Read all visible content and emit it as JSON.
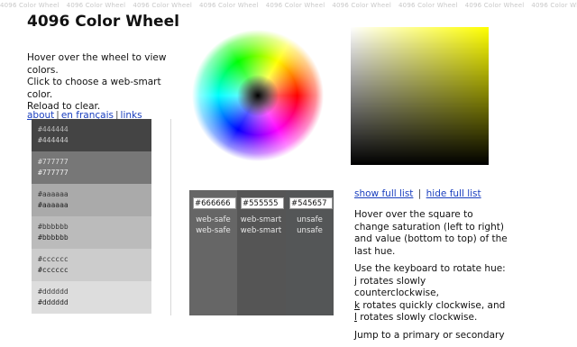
{
  "top_strip": {
    "repeat_text": "4096 Color Wheel",
    "repeat_count": 14
  },
  "title": "4096 Color Wheel",
  "intro": {
    "line1": "Hover over the wheel to view colors.",
    "line2": "Click to choose a web-smart color.",
    "line3": "Reload to clear."
  },
  "nav": {
    "about": "about",
    "french": "en français",
    "links": "links",
    "separator": "|"
  },
  "swatches": [
    {
      "bg": "#444444",
      "fg": "#cccccc",
      "v1": "#444444",
      "v2": "#444444"
    },
    {
      "bg": "#777777",
      "fg": "#eeeeee",
      "v1": "#777777",
      "v2": "#777777"
    },
    {
      "bg": "#aaaaaa",
      "fg": "#222222",
      "v1": "#aaaaaa",
      "v2": "#aaaaaa"
    },
    {
      "bg": "#bbbbbb",
      "fg": "#222222",
      "v1": "#bbbbbb",
      "v2": "#bbbbbb"
    },
    {
      "bg": "#cccccc",
      "fg": "#222222",
      "v1": "#cccccc",
      "v2": "#cccccc"
    },
    {
      "bg": "#dddddd",
      "fg": "#222222",
      "v1": "#dddddd",
      "v2": "#dddddd"
    }
  ],
  "compare": {
    "columns": [
      {
        "bg": "#666666",
        "value": "#666666",
        "label1": "web-safe",
        "label2": "web-safe"
      },
      {
        "bg": "#555555",
        "value": "#555555",
        "label1": "web-smart",
        "label2": "web-smart"
      },
      {
        "bg": "#545657",
        "value": "#545657",
        "label1": "unsafe",
        "label2": "unsafe"
      }
    ]
  },
  "list_links": {
    "show": "show full list",
    "hide": "hide full list",
    "separator": "|"
  },
  "help": {
    "p1": "Hover over the square to change saturation (left to right) and value (bottom to top) of the last hue.",
    "p2_intro": "Use the keyboard to rotate hue:",
    "j_key": "j",
    "j_text": " rotates slowly counterclockwise,",
    "k_key": "k",
    "k_text": " rotates quickly clockwise, and",
    "l_key": "l",
    "l_text": " rotates slowly clockwise.",
    "p3": "Jump to a primary or secondary"
  },
  "colors": {
    "link": "#1a3fbf",
    "square_hue": "#ffff00",
    "compare_panel": "#555555"
  }
}
